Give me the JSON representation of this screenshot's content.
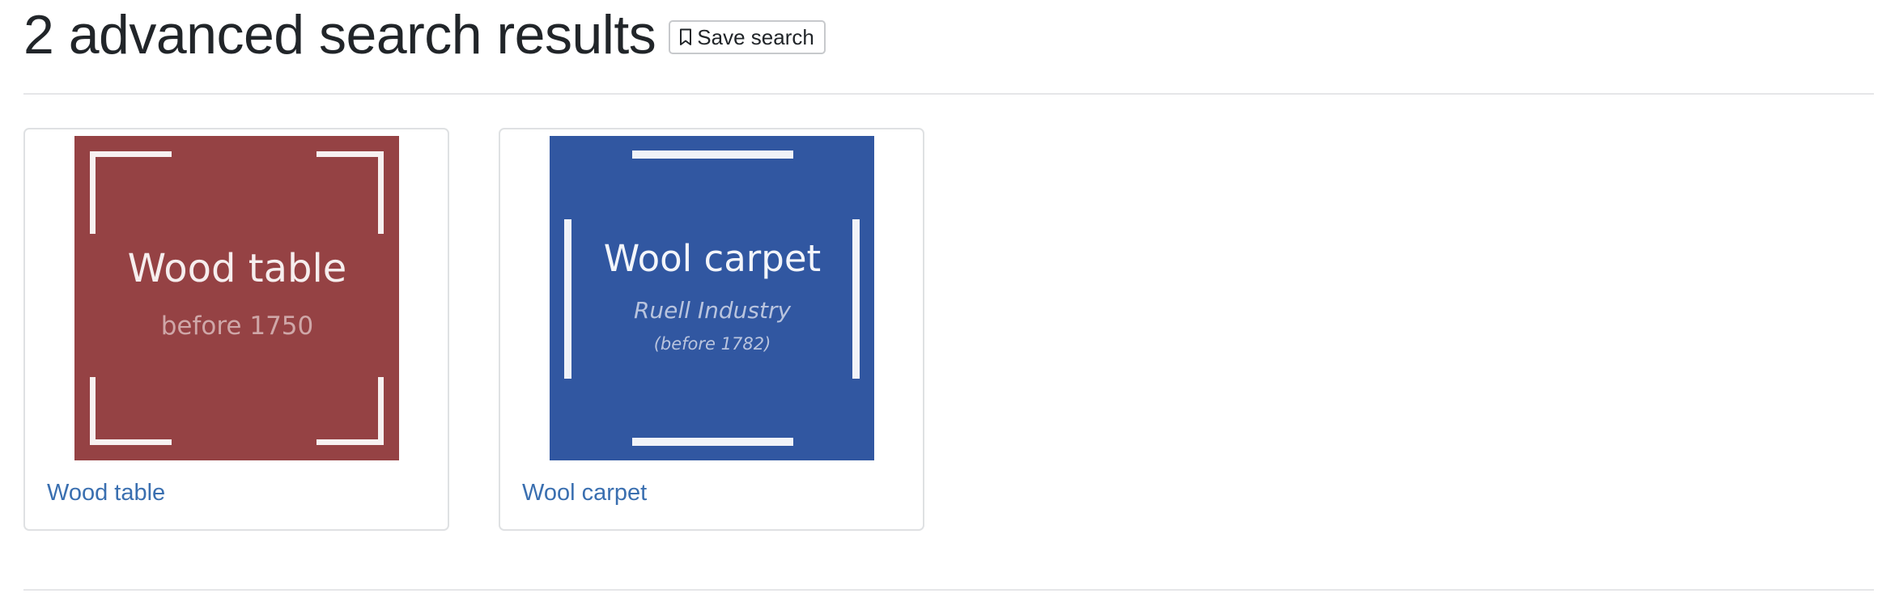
{
  "header": {
    "title": "2 advanced search results",
    "save_label": "Save search",
    "save_icon": "bookmark-icon"
  },
  "results": [
    {
      "title": "Wood table",
      "thumbnail": {
        "bg_color": "#954244",
        "line1": "Wood table",
        "line2": "before 1750"
      }
    },
    {
      "title": "Wool carpet",
      "thumbnail": {
        "bg_color": "#3157a1",
        "line1": "Wool carpet",
        "line2": "Ruell Industry",
        "line3": "(before 1782)"
      }
    }
  ]
}
